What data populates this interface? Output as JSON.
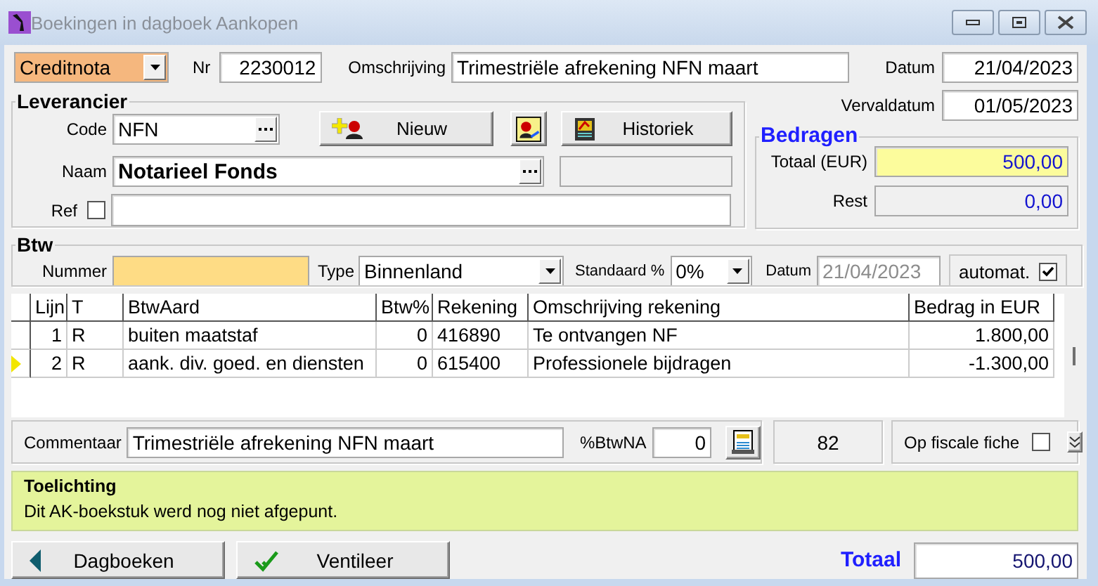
{
  "window": {
    "title": "Boekingen in dagboek Aankopen"
  },
  "header": {
    "document_type": "Creditnota",
    "nr_label": "Nr",
    "nr": "2230012",
    "description_label": "Omschrijving",
    "description": "Trimestriële afrekening NFN maart",
    "date_label": "Datum",
    "date": "21/04/2023",
    "due_label": "Vervaldatum",
    "due_date": "01/05/2023"
  },
  "supplier": {
    "title": "Leverancier",
    "code_label": "Code",
    "code": "NFN",
    "new_button": "Nieuw",
    "history_button": "Historiek",
    "name_label": "Naam",
    "name": "Notarieel Fonds",
    "ref_label": "Ref",
    "ref_checked": false
  },
  "amounts": {
    "title": "Bedragen",
    "total_label": "Totaal (EUR)",
    "total": "500,00",
    "rest_label": "Rest",
    "rest": "0,00"
  },
  "vat": {
    "title": "Btw",
    "number_label": "Nummer",
    "type_label": "Type",
    "type": "Binnenland",
    "standard_label": "Standaard %",
    "standard": "0%",
    "date_label": "Datum",
    "date": "21/04/2023",
    "date_disabled": true,
    "auto_label": "automat.",
    "auto_checked": true
  },
  "table": {
    "columns": [
      "Lijn",
      "T",
      "BtwAard",
      "Btw%",
      "Rekening",
      "Omschrijving rekening",
      "Bedrag in EUR"
    ],
    "rows": [
      {
        "selected": false,
        "cells": [
          "1",
          "R",
          "buiten maatstaf",
          "0",
          "416890",
          "Te ontvangen NF",
          "1.800,00"
        ]
      },
      {
        "selected": true,
        "cells": [
          "2",
          "R",
          "aank. div. goed. en diensten",
          "0",
          "615400",
          "Professionele bijdragen",
          "-1.300,00"
        ]
      }
    ]
  },
  "comment": {
    "label": "Commentaar",
    "value": "Trimestriële afrekening NFN maart",
    "pct_label": "%BtwNA",
    "pct": "0",
    "count": "82",
    "fiscal_label": "Op fiscale fiche",
    "fiscal_checked": false
  },
  "note": {
    "title": "Toelichting",
    "text": "Dit AK-boekstuk werd nog niet afgepunt."
  },
  "footer": {
    "back_button": "Dagboeken",
    "ventilate_button": "Ventileer",
    "total_label": "Totaal",
    "total": "500,00"
  }
}
